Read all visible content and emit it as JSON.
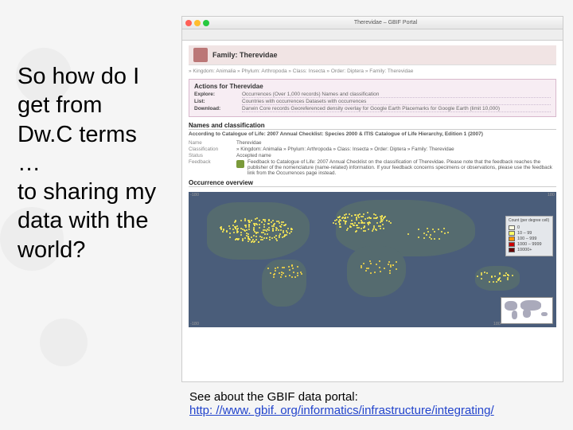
{
  "question_text": "So how do I get from Dw.C terms …\nto sharing my data with the world?",
  "caption": {
    "prefix": "See about the GBIF data portal:",
    "link_text": "http: //www. gbif. org/informatics/infrastructure/integrating/"
  },
  "browser": {
    "window_title": "Therevidae – GBIF Portal",
    "family_label": "Family:",
    "family_value": "Therevidae",
    "breadcrumbs": "» Kingdom: Animalia  » Phylum: Arthropoda  » Class: Insecta  » Order: Diptera  » Family: Therevidae",
    "actions": {
      "title": "Actions for Therevidae",
      "rows": [
        {
          "label": "Explore:",
          "value": "Occurrences (Over 1,000 records)    Names and classification"
        },
        {
          "label": "List:",
          "value": "Countries with occurrences    Datasets with occurrences"
        },
        {
          "label": "Download:",
          "value": "Darwin Core records    Georeferenced density overlay for Google Earth    Placemarks for Google Earth (limit 10,000)"
        }
      ]
    },
    "names_class": {
      "title": "Names and classification",
      "cofl": "According to Catalogue of Life: 2007 Annual Checklist: Species 2000 & ITIS Catalogue of Life Hierarchy, Edition 1 (2007)",
      "rows": [
        {
          "label": "Name",
          "value": "Therevidae"
        },
        {
          "label": "Classification",
          "value": "» Kingdom: Animalia  » Phylum: Arthropoda  » Class: Insecta  » Order: Diptera  » Family: Therevidae"
        },
        {
          "label": "Status",
          "value": "Accepted name"
        },
        {
          "label": "Feedback",
          "value": "Feedback to Catalogue of Life: 2007 Annual Checklist on the classification of Therevidae. Please note that the feedback reaches the publisher of the nomenclature (name-related) information. If your feedback concerns specimens or observations, please use the feedback link from the Occurrences page instead."
        }
      ]
    },
    "occurrence": {
      "title": "Occurrence overview",
      "axis_left": "-180",
      "axis_right": "180",
      "legend_title": "Count (per degree cell)",
      "legend_rows": [
        {
          "color": "#fffde0",
          "label": "0"
        },
        {
          "color": "#ffff66",
          "label": "10 – 99"
        },
        {
          "color": "#ff9900",
          "label": "100 – 999"
        },
        {
          "color": "#cc0000",
          "label": "1000 – 9999"
        },
        {
          "color": "#660000",
          "label": "10000+"
        }
      ]
    }
  }
}
